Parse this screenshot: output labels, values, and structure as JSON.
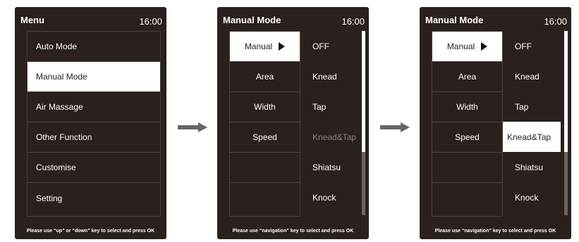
{
  "screen1": {
    "title": "Menu",
    "time": "16:00",
    "items": [
      "Auto Mode",
      "Manual Mode",
      "Air Massage",
      "Other Function",
      "Customise",
      "Setting"
    ],
    "footer": "Please use “up” or “down” key to select and press OK"
  },
  "screen2": {
    "title": "Manual Mode",
    "time": "16:00",
    "categories": [
      "Manual",
      "Area",
      "Width",
      "Speed",
      "",
      ""
    ],
    "options": [
      "OFF",
      "Knead",
      "Tap",
      "Knead&Tap",
      "Shiatsu",
      "Knock"
    ],
    "footer": "Please use “navigation” key to select and press OK"
  },
  "screen3": {
    "title": "Manual Mode",
    "time": "16:00",
    "categories": [
      "Manual",
      "Area",
      "Width",
      "Speed",
      "",
      ""
    ],
    "options": [
      "OFF",
      "Knead",
      "Tap",
      "Knead&Tap",
      "Shiatsu",
      "Knock"
    ],
    "footer": "Please use “navigation” key to select and press OK"
  }
}
